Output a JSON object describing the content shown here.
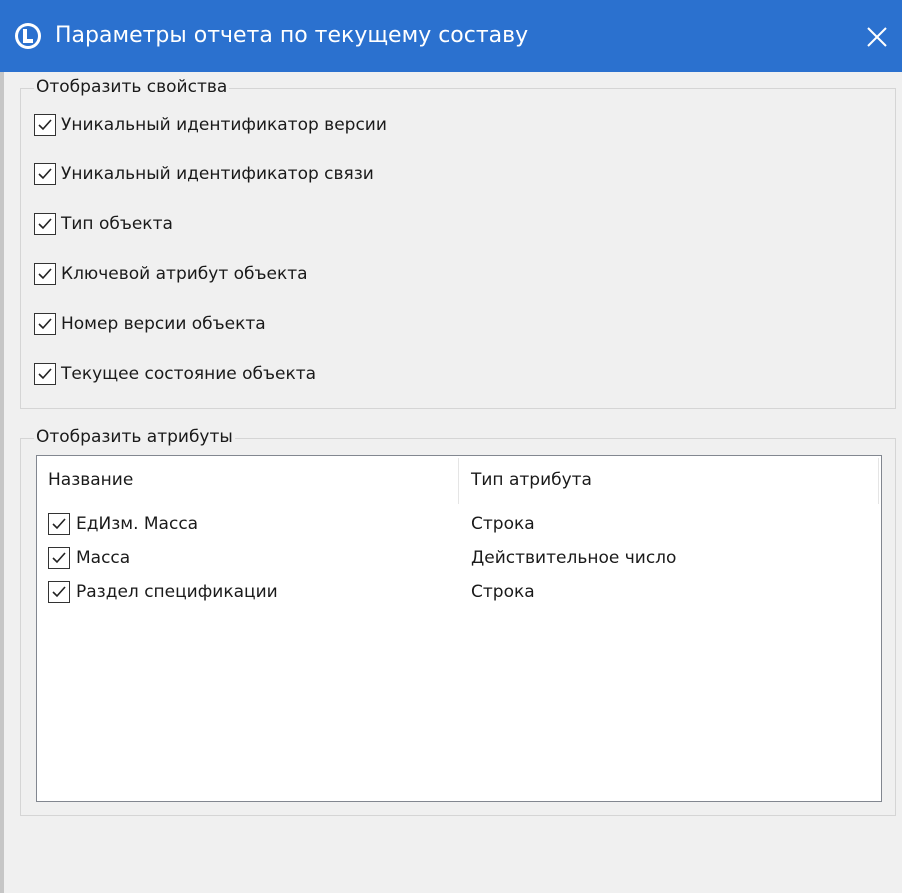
{
  "window": {
    "title": "Параметры отчета по текущему составу",
    "title_bar_color": "#2b71cf"
  },
  "properties_group": {
    "legend": "Отобразить свойства",
    "items": [
      {
        "label": "Уникальный идентификатор версии",
        "checked": true
      },
      {
        "label": "Уникальный идентификатор связи",
        "checked": true
      },
      {
        "label": "Тип объекта",
        "checked": true
      },
      {
        "label": "Ключевой атрибут объекта",
        "checked": true
      },
      {
        "label": "Номер версии объекта",
        "checked": true
      },
      {
        "label": "Текущее состояние объекта",
        "checked": true
      }
    ]
  },
  "attributes_group": {
    "legend": "Отобразить атрибуты",
    "columns": [
      "Название",
      "Тип атрибута"
    ],
    "rows": [
      {
        "name": "ЕдИзм. Масса",
        "type": "Строка",
        "checked": true
      },
      {
        "name": "Масса",
        "type": "Действительное число",
        "checked": true
      },
      {
        "name": "Раздел спецификации",
        "type": "Строка",
        "checked": true
      }
    ]
  },
  "icons": {
    "app": "app-logo-icon",
    "close": "close-icon",
    "check": "checkmark-icon"
  }
}
